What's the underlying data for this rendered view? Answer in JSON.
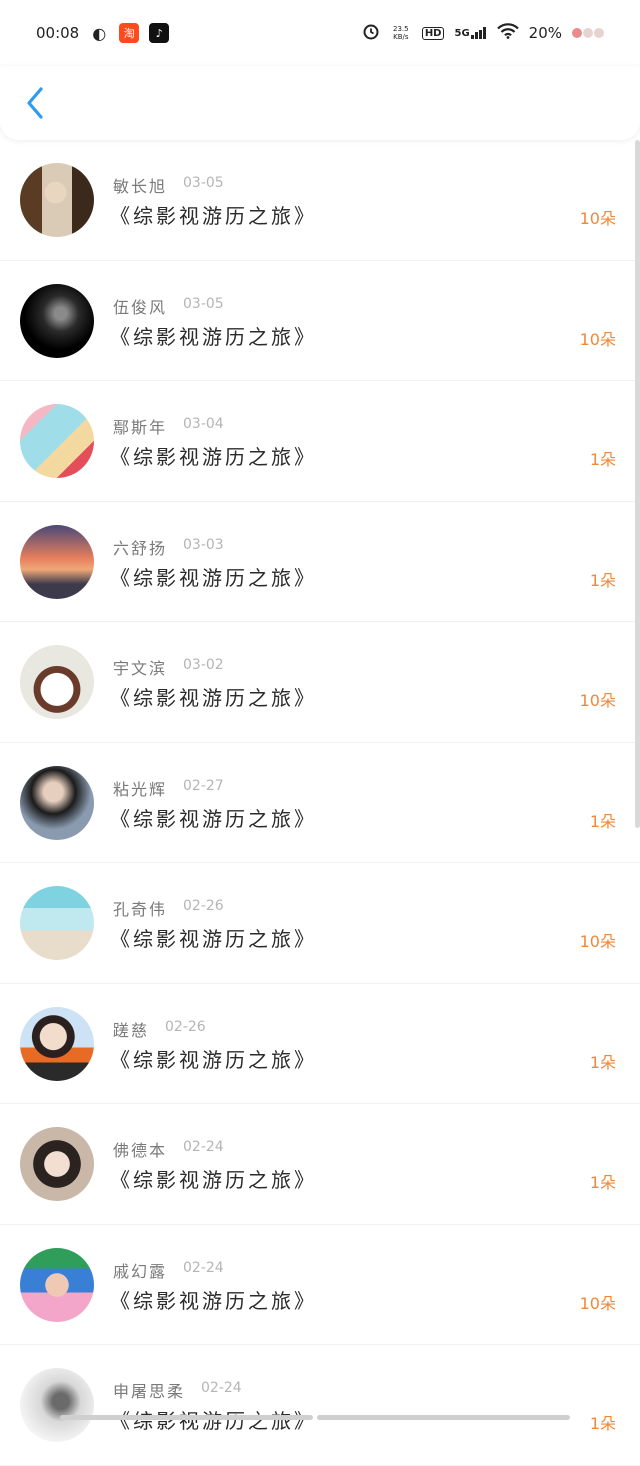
{
  "status_bar": {
    "time": "00:08",
    "net_speed": "23.5 KB/s",
    "hd": "HD",
    "network": "5G",
    "battery": "20%",
    "tiktok_glyph": "♪",
    "leaf_glyph": "◐",
    "taobao_glyph": "淘"
  },
  "header": {
    "back_icon": "chevron-left-icon"
  },
  "colors": {
    "accent": "#2f9bf0",
    "amount": "#f0883a",
    "name": "#7a7a7a",
    "date": "#b5b5b5"
  },
  "rows": [
    {
      "name": "敏长旭",
      "date": "03-05",
      "title": "《综影视游历之旅》",
      "amount": "10朵",
      "avatar": "a1"
    },
    {
      "name": "伍俊风",
      "date": "03-05",
      "title": "《综影视游历之旅》",
      "amount": "10朵",
      "avatar": "a2"
    },
    {
      "name": "鄢斯年",
      "date": "03-04",
      "title": "《综影视游历之旅》",
      "amount": "1朵",
      "avatar": "a3"
    },
    {
      "name": "六舒扬",
      "date": "03-03",
      "title": "《综影视游历之旅》",
      "amount": "1朵",
      "avatar": "a4"
    },
    {
      "name": "宇文滨",
      "date": "03-02",
      "title": "《综影视游历之旅》",
      "amount": "10朵",
      "avatar": "a5"
    },
    {
      "name": "粘光辉",
      "date": "02-27",
      "title": "《综影视游历之旅》",
      "amount": "1朵",
      "avatar": "a6"
    },
    {
      "name": "孔奇伟",
      "date": "02-26",
      "title": "《综影视游历之旅》",
      "amount": "10朵",
      "avatar": "a7"
    },
    {
      "name": "蹉慈",
      "date": "02-26",
      "title": "《综影视游历之旅》",
      "amount": "1朵",
      "avatar": "a8"
    },
    {
      "name": "佛德本",
      "date": "02-24",
      "title": "《综影视游历之旅》",
      "amount": "1朵",
      "avatar": "a9"
    },
    {
      "name": "戚幻露",
      "date": "02-24",
      "title": "《综影视游历之旅》",
      "amount": "10朵",
      "avatar": "a10"
    },
    {
      "name": "申屠思柔",
      "date": "02-24",
      "title": "《综影视游历之旅》",
      "amount": "1朵",
      "avatar": "a11"
    }
  ]
}
